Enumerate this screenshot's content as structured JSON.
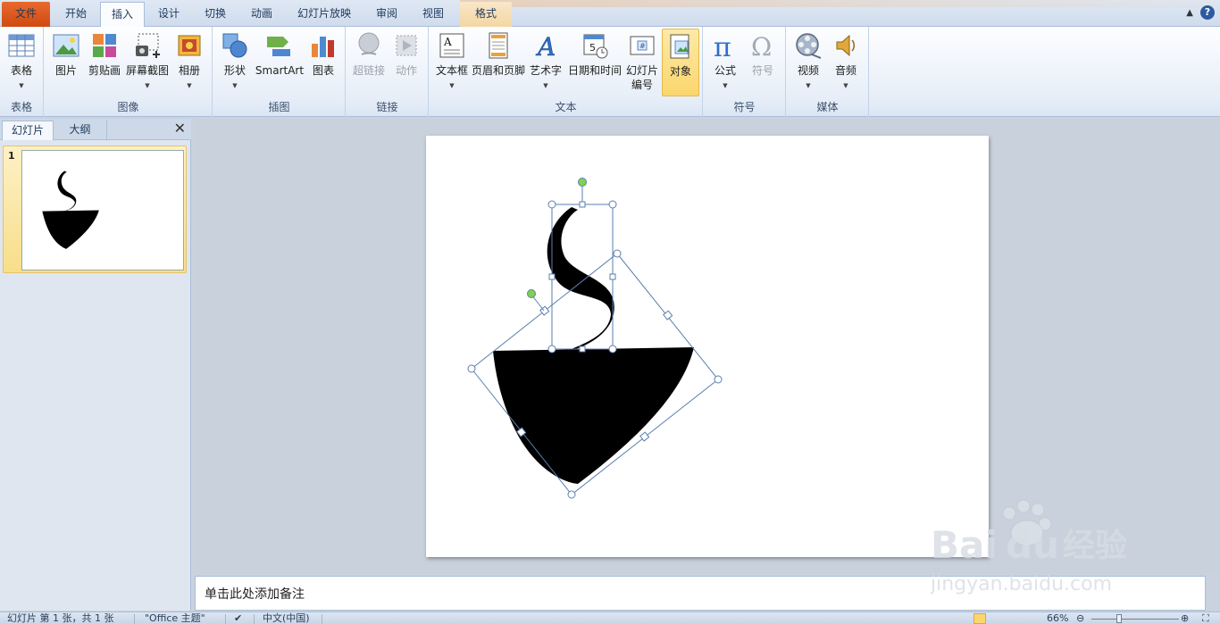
{
  "tabs": {
    "file": "文件",
    "home": "开始",
    "insert": "插入",
    "design": "设计",
    "transitions": "切换",
    "animations": "动画",
    "slideshow": "幻灯片放映",
    "review": "审阅",
    "view": "视图",
    "format": "格式"
  },
  "ribbon": {
    "groups": {
      "tables": "表格",
      "images": "图像",
      "illustrations": "插图",
      "links": "链接",
      "text": "文本",
      "symbols": "符号",
      "media": "媒体"
    },
    "buttons": {
      "table": "表格",
      "picture": "图片",
      "clipart": "剪贴画",
      "screenshot": "屏幕截图",
      "album": "相册",
      "shapes": "形状",
      "smartart": "SmartArt",
      "chart": "图表",
      "hyperlink": "超链接",
      "action": "动作",
      "textbox": "文本框",
      "header_footer": "页眉和页脚",
      "wordart": "艺术字",
      "datetime": "日期和时间",
      "slide_number_1": "幻灯片",
      "slide_number_2": "编号",
      "object": "对象",
      "equation": "公式",
      "symbol": "符号",
      "video": "视频",
      "audio": "音频"
    }
  },
  "left_pane": {
    "tab_slides": "幻灯片",
    "tab_outline": "大纲",
    "close": "✕",
    "thumb_number": "1"
  },
  "notes_placeholder": "单击此处添加备注",
  "status": {
    "slide_info": "幻灯片 第 1 张，共 1 张",
    "theme": "\"Office 主题\"",
    "language": "中文(中国)",
    "zoom": "66%"
  },
  "watermark": {
    "brand": "Bai",
    "brand2": "du",
    "cn": "经验",
    "url": "jingyan.baidu.com"
  }
}
